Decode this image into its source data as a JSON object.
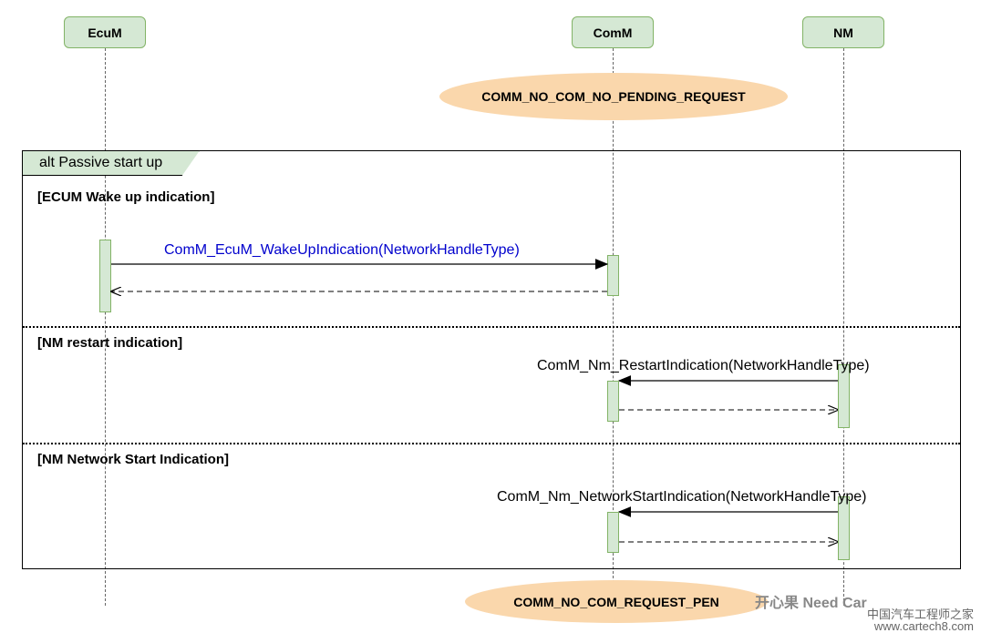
{
  "lifelines": {
    "ecum": "EcuM",
    "comm": "ComM",
    "nm": "NM"
  },
  "states": {
    "top": "COMM_NO_COM_NO_PENDING_REQUEST",
    "bottom_full": "COMM_NO_COM_REQUEST_PENDING",
    "bottom_visible": "COMM_NO_COM_REQUEST_PEN"
  },
  "frame": {
    "label": "alt Passive start up"
  },
  "sections": {
    "s1": "[ECUM Wake up indication]",
    "s2": "[NM restart indication]",
    "s3": "[NM Network Start Indication]"
  },
  "messages": {
    "m1": "ComM_EcuM_WakeUpIndication(NetworkHandleType)",
    "m2": "ComM_Nm_RestartIndication(NetworkHandleType)",
    "m3": "ComM_Nm_NetworkStartIndication(NetworkHandleType)"
  },
  "watermark": {
    "line1": "开心果 Need Car",
    "line2": "中国汽车工程师之家",
    "line3": "www.cartech8.com"
  }
}
